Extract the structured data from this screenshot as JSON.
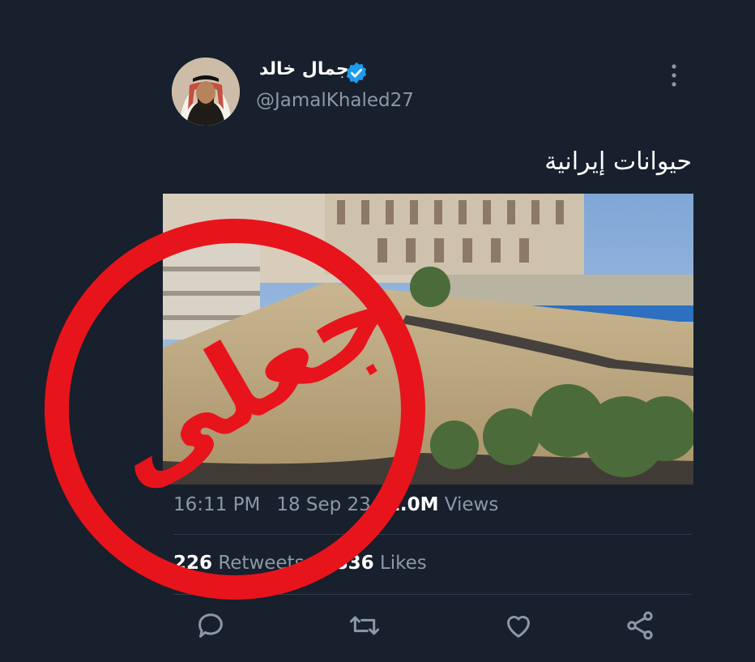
{
  "user": {
    "display_name": "جمال خالد",
    "handle": "@JamalKhaled27",
    "verified": true
  },
  "tweet": {
    "text": "حيوانات إيرانية",
    "time": "16:11 PM",
    "date": "18 Sep 23",
    "views_count": "1.0M",
    "views_label": "Views",
    "retweets_count": "226",
    "retweets_label": "Retweets",
    "likes_count": "836",
    "likes_label": "Likes"
  },
  "stamp": {
    "text": "جعلی",
    "color": "#e8141b"
  },
  "colors": {
    "background": "#17202c",
    "muted_text": "#8b98a5",
    "verified_blue": "#1d9bf0"
  },
  "icons": [
    "more-vertical-icon",
    "verified-icon",
    "reply-icon",
    "retweet-icon",
    "like-icon",
    "share-icon"
  ]
}
